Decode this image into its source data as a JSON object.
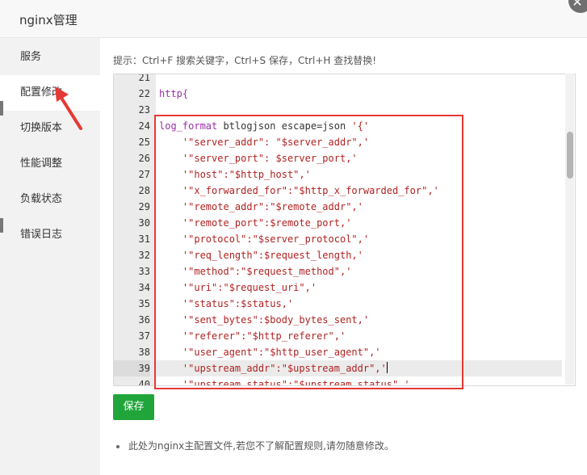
{
  "window": {
    "title": "nginx管理",
    "close_glyph": "✕"
  },
  "sidebar": {
    "items": [
      {
        "label": "服务"
      },
      {
        "label": "配置修改"
      },
      {
        "label": "切换版本"
      },
      {
        "label": "性能调整"
      },
      {
        "label": "负载状态"
      },
      {
        "label": "错误日志"
      }
    ],
    "active_index": 1
  },
  "hint": "提示：Ctrl+F 搜索关键字，Ctrl+S 保存，Ctrl+H 查找替换!",
  "editor": {
    "current_line": 39,
    "lines": [
      {
        "n": "21",
        "parts": []
      },
      {
        "n": "22",
        "parts": [
          {
            "t": "http{",
            "c": "kw"
          }
        ]
      },
      {
        "n": "23",
        "parts": []
      },
      {
        "n": "24",
        "parts": [
          {
            "t": "log_format",
            "c": "kw"
          },
          {
            "t": " btlogjson escape=json ",
            "c": "plain"
          },
          {
            "t": "'{'",
            "c": "str"
          }
        ]
      },
      {
        "n": "25",
        "parts": [
          {
            "t": "    '\"server_addr\": \"$server_addr\",'",
            "c": "str"
          }
        ]
      },
      {
        "n": "26",
        "parts": [
          {
            "t": "    '\"server_port\": $server_port,'",
            "c": "str"
          }
        ]
      },
      {
        "n": "27",
        "parts": [
          {
            "t": "    '\"host\":\"$http_host\",'",
            "c": "str"
          }
        ]
      },
      {
        "n": "28",
        "parts": [
          {
            "t": "    '\"x_forwarded_for\":\"$http_x_forwarded_for\",'",
            "c": "str"
          }
        ]
      },
      {
        "n": "29",
        "parts": [
          {
            "t": "    '\"remote_addr\":\"$remote_addr\",'",
            "c": "str"
          }
        ]
      },
      {
        "n": "30",
        "parts": [
          {
            "t": "    '\"remote_port\":$remote_port,'",
            "c": "str"
          }
        ]
      },
      {
        "n": "31",
        "parts": [
          {
            "t": "    '\"protocol\":\"$server_protocol\",'",
            "c": "str"
          }
        ]
      },
      {
        "n": "32",
        "parts": [
          {
            "t": "    '\"req_length\":$request_length,'",
            "c": "str"
          }
        ]
      },
      {
        "n": "33",
        "parts": [
          {
            "t": "    '\"method\":\"$request_method\",'",
            "c": "str"
          }
        ]
      },
      {
        "n": "34",
        "parts": [
          {
            "t": "    '\"uri\":\"$request_uri\",'",
            "c": "str"
          }
        ]
      },
      {
        "n": "35",
        "parts": [
          {
            "t": "    '\"status\":$status,'",
            "c": "str"
          }
        ]
      },
      {
        "n": "36",
        "parts": [
          {
            "t": "    '\"sent_bytes\":$body_bytes_sent,'",
            "c": "str"
          }
        ]
      },
      {
        "n": "37",
        "parts": [
          {
            "t": "    '\"referer\":\"$http_referer\",'",
            "c": "str"
          }
        ]
      },
      {
        "n": "38",
        "parts": [
          {
            "t": "    '\"user_agent\":\"$http_user_agent\",'",
            "c": "str"
          }
        ]
      },
      {
        "n": "39",
        "parts": [
          {
            "t": "    '\"upstream_addr\":\"$upstream_addr\",'",
            "c": "str"
          }
        ]
      },
      {
        "n": "40",
        "parts": [
          {
            "t": "    '\"upstream_status\":\"$upstream_status\",'",
            "c": "str"
          }
        ]
      }
    ]
  },
  "save_button": "保存",
  "note": "此处为nginx主配置文件,若您不了解配置规则,请勿随意修改。",
  "colors": {
    "accent_green": "#20a53a",
    "annotation_red": "#e53935",
    "keyword_purple": "#9b2fa8",
    "string_red": "#b22222"
  },
  "icons": [
    "close-icon",
    "red-arrow-annotation-icon",
    "bullet-icon"
  ]
}
